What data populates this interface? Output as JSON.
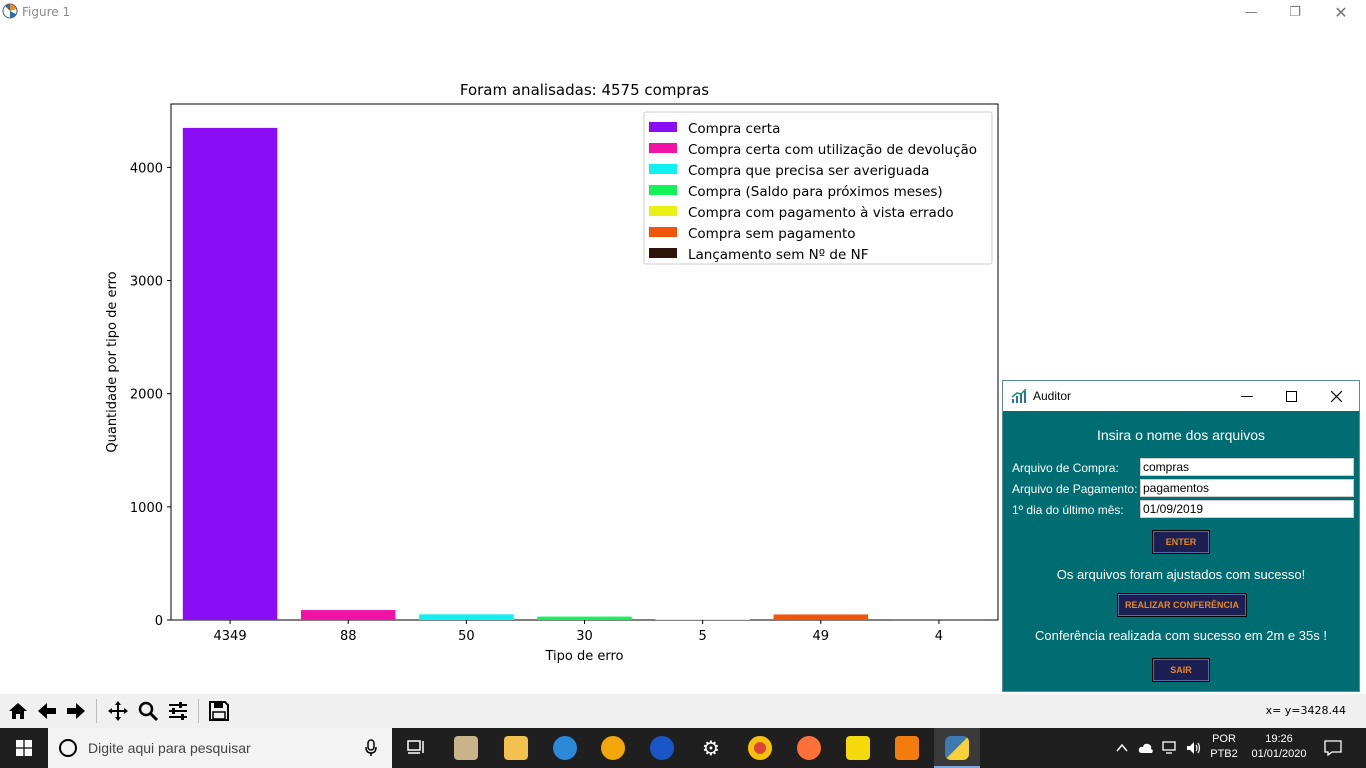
{
  "window": {
    "title": "Figure 1"
  },
  "chart_data": {
    "type": "bar",
    "title": "Foram analisadas: 4575 compras",
    "xlabel": "Tipo de erro",
    "ylabel": "Quantidade por tipo de erro",
    "categories": [
      "4349",
      "88",
      "50",
      "30",
      "5",
      "49",
      "4"
    ],
    "values": [
      4349,
      88,
      50,
      30,
      5,
      49,
      4
    ],
    "ylim": [
      0,
      4560
    ],
    "yticks": [
      0,
      1000,
      2000,
      3000,
      4000
    ],
    "legend_position": "top-right",
    "series_colors": [
      "#8a0df5",
      "#f212a6",
      "#0ff0f0",
      "#14f25a",
      "#e8f014",
      "#f2540a",
      "#2d140a"
    ],
    "legend": [
      "Compra certa",
      "Compra certa com utilização de devolução",
      "Compra que precisa ser averiguada",
      "Compra (Saldo para próximos meses)",
      "Compra com pagamento à vista errado",
      "Compra sem pagamento",
      "Lançamento sem Nº de NF"
    ]
  },
  "toolbar": {
    "coordinates": "x= y=3428.44"
  },
  "auditor": {
    "title": "Auditor",
    "heading": "Insira o nome dos arquivos",
    "compra_label": "Arquivo de Compra:",
    "compra_value": "compras",
    "pagamento_label": "Arquivo de Pagamento:",
    "pagamento_value": "pagamentos",
    "dia_label": "1º dia do último mês:",
    "dia_value": "01/09/2019",
    "enter_label": "ENTER",
    "ajuste_msg": "Os arquivos foram ajustados com sucesso!",
    "conferencia_label": "REALIZAR CONFERÊNCIA",
    "conferencia_msg": "Conferência realizada com sucesso em 2m e 35s !",
    "sair_label": "SAIR"
  },
  "taskbar": {
    "search_placeholder": "Digite aqui para pesquisar",
    "lang_top": "POR",
    "lang_bottom": "PTB2",
    "time": "19:26",
    "date": "01/01/2020"
  },
  "colors": {
    "auditor_bg": "#006d72",
    "button_bg": "#1b1f53",
    "button_text": "#e88a1e",
    "taskbar": "#1f1f1f"
  }
}
